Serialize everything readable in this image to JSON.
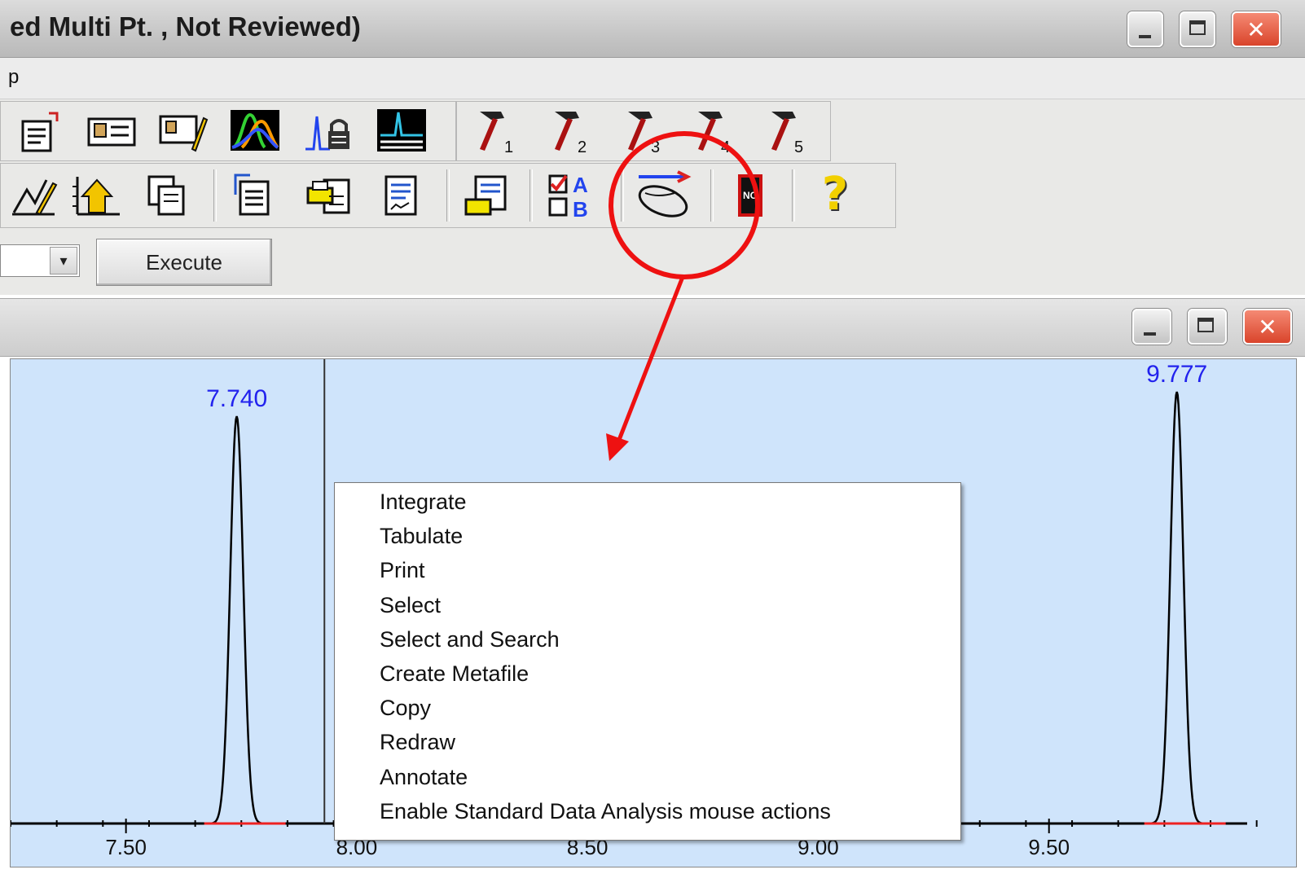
{
  "window": {
    "title": "ed Multi Pt. , Not Reviewed)",
    "close_glyph": "✕"
  },
  "menubar": {
    "partial_item": "p"
  },
  "toolbar": {
    "row1_icons": [
      "report-icon",
      "sample-info-icon",
      "edit-info-icon",
      "spectrum-icon",
      "peak-lock-icon",
      "chromatogram-icon",
      "method-tool-1-icon",
      "method-tool-2-icon",
      "method-tool-3-icon",
      "method-tool-4-icon",
      "method-tool-5-icon"
    ],
    "row1_tool_numbers": [
      "1",
      "2",
      "3",
      "4",
      "5"
    ],
    "row2_icons": [
      "edit-chart-icon",
      "axis-scale-icon",
      "copy-window-icon",
      "document-copy-icon",
      "print-icon",
      "report-doc-icon",
      "print-report-icon",
      "ab-compare-icon",
      "mouse-action-icon",
      "flag-icon",
      "help-icon"
    ],
    "ab_labels": [
      "A",
      "B"
    ],
    "help_glyph": "?",
    "execute_label": "Execute",
    "dropdown_glyph": "▾"
  },
  "child_window": {
    "close_glyph": "✕"
  },
  "chart_data": {
    "type": "line",
    "x_ticks": [
      "7.50",
      "8.00",
      "8.50",
      "9.00",
      "9.50"
    ],
    "xlim": [
      7.25,
      10.0
    ],
    "peaks": [
      {
        "x": 7.74,
        "label": "7.740"
      },
      {
        "x": 9.777,
        "label": "9.777"
      }
    ],
    "cursor_x": 7.93,
    "colors": {
      "background": "#cfe4fb",
      "trace": "#000000",
      "peak_label": "#2222ee",
      "baseline": "#ee2222"
    }
  },
  "context_menu": {
    "items": [
      "Integrate",
      "Tabulate",
      "Print",
      "Select",
      "Select and Search",
      "Create Metafile",
      "Copy",
      "Redraw",
      "Annotate",
      "Enable Standard Data Analysis mouse actions"
    ]
  },
  "annotation": {
    "color": "#ee1111",
    "target": "mouse-action-icon"
  }
}
